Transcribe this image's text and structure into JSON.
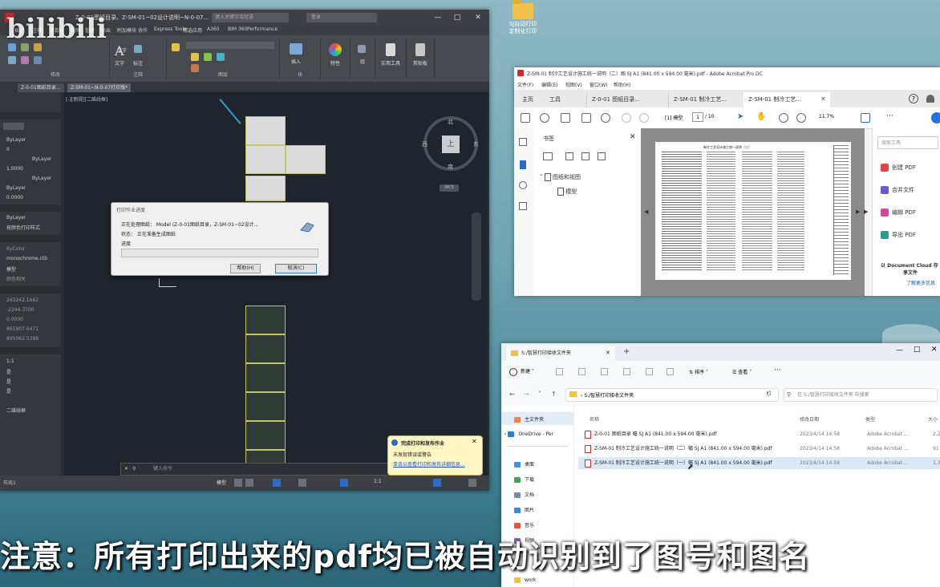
{
  "desktop": {
    "icon_label_1": "SJ自动打印",
    "icon_label_2": "定制化打印"
  },
  "watermark": "bilibili",
  "subtitle": "注意：所有打印出来的pdf均已被自动识别到了图号和图名",
  "autocad": {
    "title": "Z-0-01图纸目录、Z-SM-01~02设计说明~N-0-07...",
    "search_placeholder": "键入关键字或短语",
    "user": "登录",
    "menu": [
      "插入",
      "注释",
      "参数化",
      "视图",
      "管理",
      "输出",
      "附加模块",
      "协作",
      "Express Tools",
      "精选应用",
      "A360",
      "BIM 360",
      "Performance"
    ],
    "ribbon_groups": [
      "修改",
      "注释",
      "图层",
      "块",
      "特性",
      "组",
      "实用工具",
      "剪贴板"
    ],
    "ribbon_buttons": [
      "文字",
      "标注",
      "插入",
      "特性",
      "组",
      "实用工具",
      "剪贴板"
    ],
    "tabs": [
      "Z-0-01图纸目录...",
      "Z-SM-01~N-0-07打印版*"
    ],
    "viewport_label": "[-][俯视][二维线框]",
    "properties": {
      "layer": "ByLayer",
      "color_val": "0",
      "linetype": "ByLayer",
      "scale": "1.0000",
      "lineweight": "ByLayer",
      "transparency": "ByLayer",
      "thickness": "0.0000",
      "plot_style": "ByLayer",
      "plot_style2": "按颜色打印样式",
      "plot_color": "ByColor",
      "plot_table": "monochrome.ctb",
      "model": "模型",
      "ucs": "颜色相关",
      "x": "243242.1662",
      "y": "-2244.3700",
      "z": "0.0000",
      "cx": "865907.6471",
      "cy": "895062.5388",
      "s1": "1:1",
      "s2": "是",
      "s3": "是",
      "s4": "是",
      "wire": "二维线框"
    },
    "compass": {
      "north": "北",
      "west": "西",
      "east": "东",
      "south": "南",
      "top": "上",
      "wcs": "WCS"
    },
    "command_placeholder": "键入命令",
    "model_tab": "布局1",
    "status_model": "模型",
    "status_scale": "1:1",
    "dialog": {
      "title": "打印作业进度",
      "line1": "正在处理图纸：  Model  (Z-0-01图纸目录，Z-SM-01~02设计...",
      "line2": "状态：  正在准备生成图纸",
      "progress_label": "进度",
      "help": "帮助(H)",
      "cancel": "取消(C)"
    },
    "notification": {
      "title": "完成打印和发布作业",
      "line1": "未发现错误或警告",
      "link": "单击以查看打印和发布详细信息..."
    }
  },
  "acrobat": {
    "title": "Z-SM-01 制冷工艺设计施工统一说明（二）图 SJ A1 (841.00 x 594.00 毫米).pdf - Adobe Acrobat Pro DC",
    "menu": [
      "文件(F)",
      "编辑(E)",
      "视图(V)",
      "窗口(W)",
      "帮助(H)"
    ],
    "nav": [
      "主页",
      "工具"
    ],
    "tabs": [
      "Z-0-01 图纸目录...",
      "Z-SM-01 制冷工艺...",
      "Z-SM-01 制冷工艺..."
    ],
    "page_current": "1",
    "page_total": "/ 10",
    "zoom": "11.7%",
    "model_label": "[1] 模型",
    "bookmark_title": "书签",
    "bookmarks": [
      "图纸和视图",
      "模型"
    ],
    "search_tools": "搜索工具",
    "right_tools": [
      {
        "label": "创建 PDF",
        "color": "#e0474c"
      },
      {
        "label": "合并文件",
        "color": "#6a5acd"
      },
      {
        "label": "编辑 PDF",
        "color": "#d14a9b"
      },
      {
        "label": "导出 PDF",
        "color": "#2a9d8f"
      }
    ],
    "cloud_line1": "以 Document Cloud 存",
    "cloud_line2": "享文件",
    "cloud_link": "了解更多信息",
    "page_title": "制冷工艺设计施工统一说明（二）"
  },
  "explorer": {
    "tab_title": "S:/智慧打印接收文件夹",
    "new_btn": "新建",
    "sort_btn": "排序",
    "view_btn": "查看",
    "more": "···",
    "address": "S:/智慧打印接收文件夹",
    "search_placeholder": "在 S:/智慧打印接收文件夹 中搜索",
    "nav": [
      {
        "label": "主文件夹",
        "color": "#e8844d"
      },
      {
        "label": "OneDrive - Per",
        "color": "#2f7fd1"
      },
      {
        "label": "桌面",
        "color": "#4a8fd9"
      },
      {
        "label": "下载",
        "color": "#3da45a"
      },
      {
        "label": "文档",
        "color": "#7a8da0"
      },
      {
        "label": "图片",
        "color": "#3a8bd1"
      },
      {
        "label": "音乐",
        "color": "#e4573d"
      },
      {
        "label": "视频",
        "color": "#8a5fd0"
      },
      {
        "label": "work",
        "color": "#f0c14b"
      }
    ],
    "columns": [
      "名称",
      "修改日期",
      "类型",
      "大小"
    ],
    "files": [
      {
        "name": "Z-0-01 图纸目录 幅 SJ A1 (841.00 x 594.00 毫米).pdf",
        "date": "2023/4/14 14:58",
        "type": "Adobe Acrobat ...",
        "size": "2,20"
      },
      {
        "name": "Z-SM-01 制冷工艺设计施工统一说明（二）幅 SJ A1 (841.00 x 594.00 毫米).pdf",
        "date": "2023/4/14 14:58",
        "type": "Adobe Acrobat ...",
        "size": "91"
      },
      {
        "name": "Z-SM-01 制冷工艺设计施工统一说明（一）幅 SJ A1 (841.00 x 594.00 毫米).pdf",
        "date": "2023/4/14 14:58",
        "type": "Adobe Acrobat ...",
        "size": "1,38"
      }
    ]
  }
}
